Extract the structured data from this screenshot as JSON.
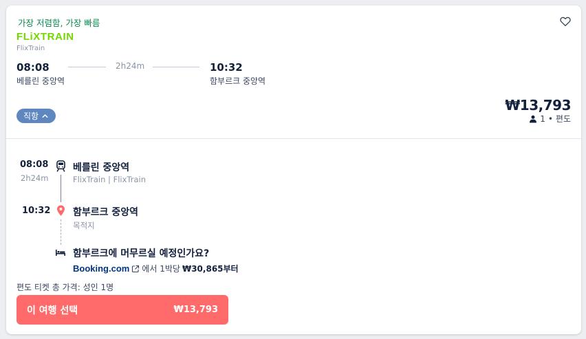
{
  "summary": {
    "badge": "가장 저렴함, 가장 빠름",
    "logo_text": "FLiXTRAIN",
    "operator": "FlixTrain",
    "departure_time": "08:08",
    "departure_station": "베를린 중앙역",
    "duration": "2h24m",
    "arrival_time": "10:32",
    "arrival_station": "함부르크 중앙역",
    "direct_label": "직항",
    "price": "₩13,793",
    "passengers": "1",
    "trip_type": "편도"
  },
  "timeline": {
    "dep_time": "08:08",
    "duration": "2h24m",
    "dep_station": "베를린 중앙역",
    "operator_line": "FlixTrain | FlixTrain",
    "arr_time": "10:32",
    "arr_station": "함부르크 중앙역",
    "destination_label": "목적지"
  },
  "booking": {
    "question": "함부르크에 머무르실 예정인가요?",
    "brand": "Booking.com",
    "text_mid": "에서 1박당",
    "from_price": "₩30,865부터"
  },
  "footer": {
    "total_label": "편도 티켓 총 가격: 성인 1명",
    "select_label": "이 여행 선택",
    "select_price": "₩13,793"
  },
  "colors": {
    "accent_cta": "#ff6b6b",
    "brand_green": "#73d700",
    "badge_green": "#0a8a50",
    "pill_blue": "#5f87bf",
    "destination_pin": "#ff6b6b"
  },
  "icons": [
    "heart-icon",
    "chevron-up-icon",
    "person-icon",
    "train-icon",
    "location-pin-icon",
    "bed-icon",
    "external-link-icon"
  ]
}
